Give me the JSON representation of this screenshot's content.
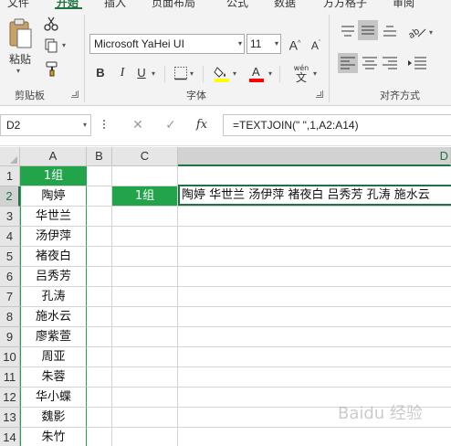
{
  "ribbon_tabs": [
    {
      "label": "文件",
      "active": false
    },
    {
      "label": "开始",
      "active": true
    },
    {
      "label": "插入",
      "active": false
    },
    {
      "label": "页面布局",
      "active": false
    },
    {
      "label": "公式",
      "active": false
    },
    {
      "label": "数据",
      "active": false
    },
    {
      "label": "方方格子",
      "active": false
    },
    {
      "label": "审阅",
      "active": false
    }
  ],
  "clipboard": {
    "paste_label": "粘贴",
    "group_label": "剪贴板"
  },
  "font": {
    "name": "Microsoft YaHei UI",
    "size": "11",
    "group_label": "字体",
    "bold": "B",
    "italic": "I",
    "underline": "U",
    "phonetic_top": "wén",
    "phonetic_bottom": "文",
    "grow": "A",
    "shrink": "A",
    "font_color": "#ff0000",
    "fill_color": "#ffff00"
  },
  "alignment": {
    "group_label": "对齐方式"
  },
  "formula_bar": {
    "name_box": "D2",
    "cancel": "✕",
    "enter": "✓",
    "fx": "fx",
    "formula": "=TEXTJOIN(\" \",1,A2:A14)"
  },
  "columns": [
    "A",
    "B",
    "C",
    "D"
  ],
  "rows": [
    "1",
    "2",
    "3",
    "4",
    "5",
    "6",
    "7",
    "8",
    "9",
    "10",
    "11",
    "12",
    "13",
    "14"
  ],
  "cells": {
    "A": [
      "1组",
      "陶婷",
      "华世兰",
      "汤伊萍",
      "褚夜白",
      "吕秀芳",
      "孔涛",
      "施水云",
      "廖紫萱",
      "周亚",
      "朱蓉",
      "华小蝶",
      "魏影",
      "朱竹"
    ],
    "C2": "1组",
    "D2": "陶婷 华世兰 汤伊萍 褚夜白 吕秀芳 孔涛 施水云"
  },
  "colors": {
    "excel_green": "#217346",
    "header_fill": "#21a44a"
  },
  "watermark": "Baidu 经验"
}
